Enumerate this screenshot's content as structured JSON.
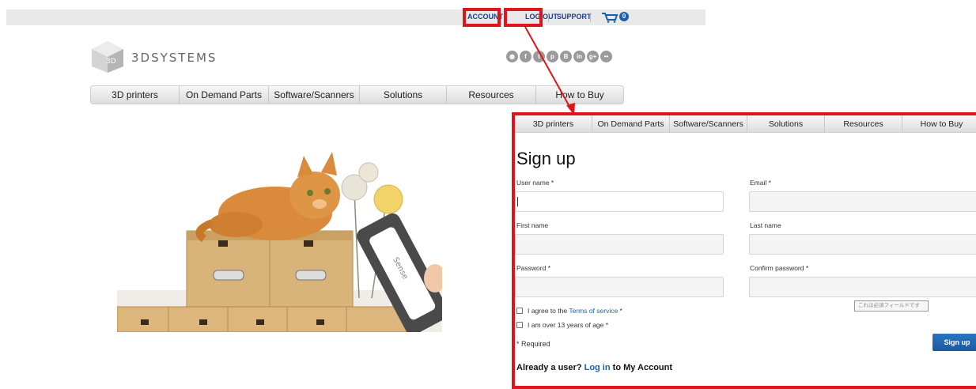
{
  "utility_nav": {
    "account": "ACCOUNT",
    "logout": "LOG OUT",
    "support": "SUPPORT",
    "cart_count": "0"
  },
  "logo": {
    "brand": "3DSYSTEMS",
    "mark": "3D"
  },
  "social_icons": [
    "rss-icon",
    "facebook-icon",
    "twitter-icon",
    "pinterest-icon",
    "blogger-icon",
    "linkedin-icon",
    "googleplus-icon",
    "flickr-icon"
  ],
  "main_nav": [
    "3D printers",
    "On Demand Parts",
    "Software/Scanners",
    "Solutions",
    "Resources",
    "How to Buy"
  ],
  "signup_panel": {
    "nav": [
      "3D printers",
      "On Demand Parts",
      "Software/Scanners",
      "Solutions",
      "Resources",
      "How to Buy"
    ],
    "title": "Sign up",
    "fields": {
      "username_label": "User name *",
      "email_label": "Email *",
      "firstname_label": "First name",
      "lastname_label": "Last name",
      "password_label": "Password *",
      "confirm_label": "Confirm password *"
    },
    "terms_prefix": "I agree to the ",
    "terms_link": "Terms of service",
    "terms_suffix": " *",
    "age_label": "I am over 13 years of age *",
    "tooltip": "これは必須フィールドです",
    "required_note": "* Required",
    "signup_button": "Sign up",
    "already_prefix": "Already a user? ",
    "login_link": "Log in",
    "already_suffix": " to My Account"
  },
  "colors": {
    "highlight": "#e0141b",
    "link": "#1a5fb4",
    "brand_blue": "#1a3d8f"
  }
}
